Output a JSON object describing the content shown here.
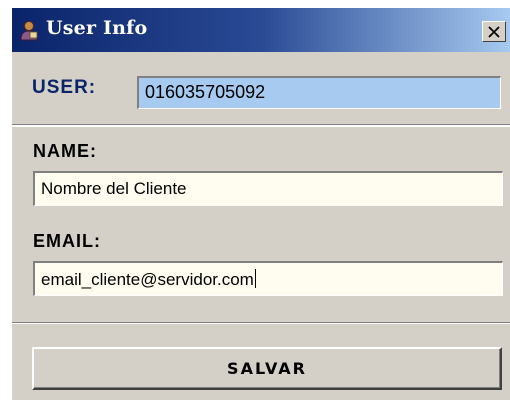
{
  "window": {
    "title": "User Info",
    "close_glyph": "X",
    "app_icon": "user-icon"
  },
  "user": {
    "label": "USER:",
    "value": "016035705092"
  },
  "name": {
    "label": "NAME:",
    "value": "Nombre del Cliente"
  },
  "email": {
    "label": "EMAIL:",
    "value": "email_cliente@servidor.com"
  },
  "actions": {
    "save_label": "SALVAR"
  },
  "colors": {
    "titlebar_start": "#0a246a",
    "titlebar_end": "#a6caf0",
    "user_field_bg": "#a6caf0",
    "dialog_bg": "#d4d0c8"
  }
}
